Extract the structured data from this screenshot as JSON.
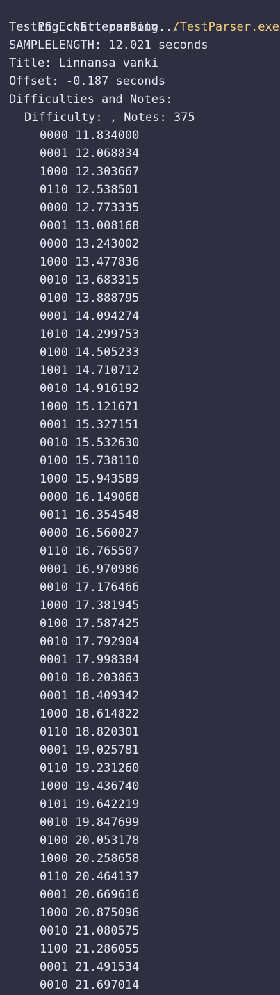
{
  "terminal": {
    "prompt": "PS E:\\EtternaBot> ",
    "command": "./TestParser.exe",
    "lines": [
      "Testing chart parsing...",
      "SAMPLELENGTH: 12.021 seconds",
      "Title: Linnansa vanki",
      "Offset: -0.187 seconds",
      "Difficulties and Notes:"
    ],
    "difficulty_line": "Difficulty: , Notes: 375",
    "notes": [
      {
        "pattern": "0000",
        "time": "11.834000"
      },
      {
        "pattern": "0001",
        "time": "12.068834"
      },
      {
        "pattern": "1000",
        "time": "12.303667"
      },
      {
        "pattern": "0110",
        "time": "12.538501"
      },
      {
        "pattern": "0000",
        "time": "12.773335"
      },
      {
        "pattern": "0001",
        "time": "13.008168"
      },
      {
        "pattern": "0000",
        "time": "13.243002"
      },
      {
        "pattern": "1000",
        "time": "13.477836"
      },
      {
        "pattern": "0010",
        "time": "13.683315"
      },
      {
        "pattern": "0100",
        "time": "13.888795"
      },
      {
        "pattern": "0001",
        "time": "14.094274"
      },
      {
        "pattern": "1010",
        "time": "14.299753"
      },
      {
        "pattern": "0100",
        "time": "14.505233"
      },
      {
        "pattern": "1001",
        "time": "14.710712"
      },
      {
        "pattern": "0010",
        "time": "14.916192"
      },
      {
        "pattern": "1000",
        "time": "15.121671"
      },
      {
        "pattern": "0001",
        "time": "15.327151"
      },
      {
        "pattern": "0010",
        "time": "15.532630"
      },
      {
        "pattern": "0100",
        "time": "15.738110"
      },
      {
        "pattern": "1000",
        "time": "15.943589"
      },
      {
        "pattern": "0000",
        "time": "16.149068"
      },
      {
        "pattern": "0011",
        "time": "16.354548"
      },
      {
        "pattern": "0000",
        "time": "16.560027"
      },
      {
        "pattern": "0110",
        "time": "16.765507"
      },
      {
        "pattern": "0001",
        "time": "16.970986"
      },
      {
        "pattern": "0010",
        "time": "17.176466"
      },
      {
        "pattern": "1000",
        "time": "17.381945"
      },
      {
        "pattern": "0100",
        "time": "17.587425"
      },
      {
        "pattern": "0010",
        "time": "17.792904"
      },
      {
        "pattern": "0001",
        "time": "17.998384"
      },
      {
        "pattern": "0010",
        "time": "18.203863"
      },
      {
        "pattern": "0001",
        "time": "18.409342"
      },
      {
        "pattern": "1000",
        "time": "18.614822"
      },
      {
        "pattern": "0110",
        "time": "18.820301"
      },
      {
        "pattern": "0001",
        "time": "19.025781"
      },
      {
        "pattern": "0110",
        "time": "19.231260"
      },
      {
        "pattern": "1000",
        "time": "19.436740"
      },
      {
        "pattern": "0101",
        "time": "19.642219"
      },
      {
        "pattern": "0010",
        "time": "19.847699"
      },
      {
        "pattern": "0100",
        "time": "20.053178"
      },
      {
        "pattern": "1000",
        "time": "20.258658"
      },
      {
        "pattern": "0110",
        "time": "20.464137"
      },
      {
        "pattern": "0001",
        "time": "20.669616"
      },
      {
        "pattern": "1000",
        "time": "20.875096"
      },
      {
        "pattern": "0010",
        "time": "21.080575"
      },
      {
        "pattern": "1100",
        "time": "21.286055"
      },
      {
        "pattern": "0001",
        "time": "21.491534"
      },
      {
        "pattern": "0010",
        "time": "21.697014"
      }
    ]
  },
  "colors": {
    "background": "#2e2f41",
    "text": "#e6e8f2",
    "command": "#f2cf7a"
  }
}
